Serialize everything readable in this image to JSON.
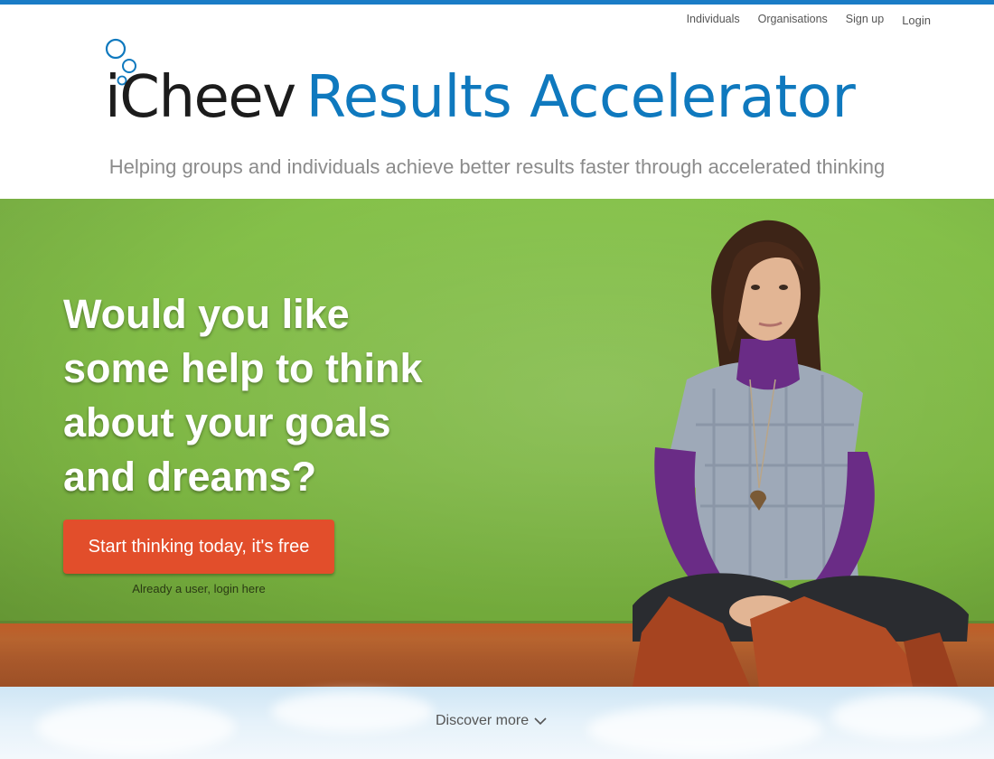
{
  "nav": {
    "items": [
      {
        "label": "Individuals"
      },
      {
        "label": "Organisations"
      },
      {
        "label": "Sign up"
      },
      {
        "label": "Login"
      }
    ]
  },
  "logo": {
    "brand": "iCheev",
    "product": "Results Accelerator"
  },
  "tagline": "Helping groups and individuals achieve better results faster through accelerated thinking",
  "hero": {
    "headline": "Would you like some help to think about your goals and dreams?",
    "cta_label": "Start thinking today, it's free",
    "login_link": "Already a user, login here"
  },
  "discover": {
    "label": "Discover more",
    "icon": "chevron-down-icon"
  },
  "colors": {
    "accent": "#0f79be",
    "cta": "#e24e2b",
    "hero_green": "#80bb46",
    "top_strip": "#1a7cc6"
  }
}
